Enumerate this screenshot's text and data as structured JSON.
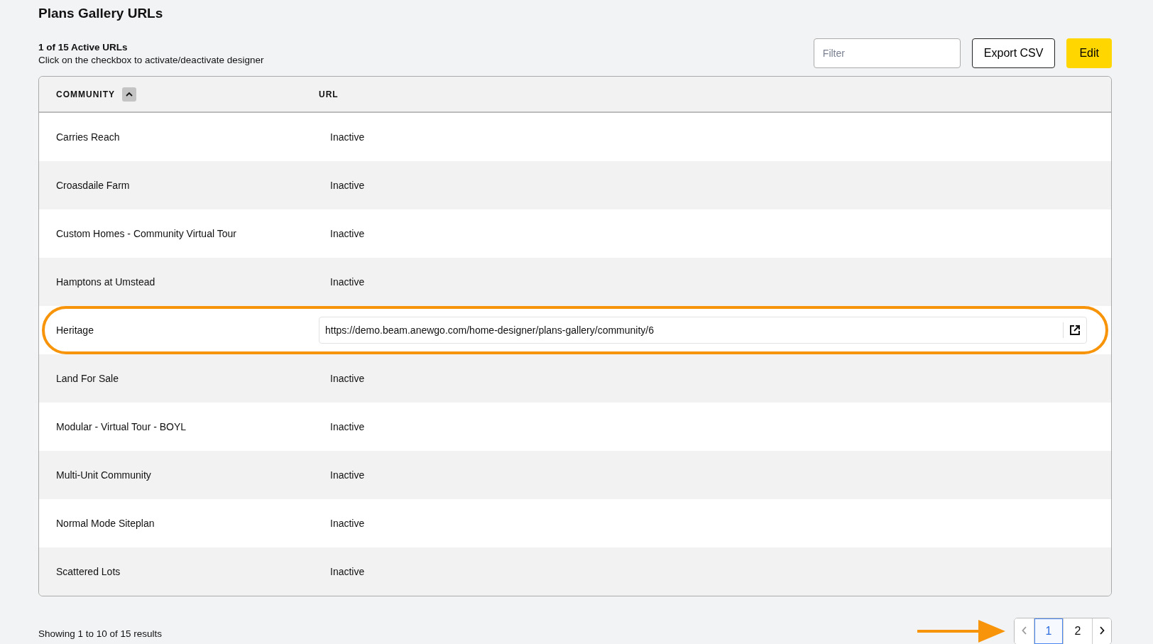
{
  "title": "Plans Gallery URLs",
  "summary": {
    "count": "1 of 15 Active URLs",
    "hint": "Click on the checkbox to activate/deactivate designer"
  },
  "filter": {
    "placeholder": "Filter"
  },
  "buttons": [
    {
      "label": "Export CSV",
      "kind": "outline"
    },
    {
      "label": "Edit",
      "kind": "primary"
    }
  ],
  "table": {
    "columns": [
      {
        "label": "COMMUNITY",
        "sorted": true
      },
      {
        "label": "URL",
        "sorted": false
      }
    ],
    "rows": [
      {
        "community": "Carries Reach",
        "active": false,
        "url": "Inactive",
        "annotated": false
      },
      {
        "community": "Croasdaile Farm",
        "active": false,
        "url": "Inactive",
        "annotated": false
      },
      {
        "community": "Custom Homes - Community Virtual Tour",
        "active": false,
        "url": "Inactive",
        "annotated": false
      },
      {
        "community": "Hamptons at Umstead",
        "active": false,
        "url": "Inactive",
        "annotated": false
      },
      {
        "community": "Heritage",
        "active": true,
        "url": "https://demo.beam.anewgo.com/home-designer/plans-gallery/community/6",
        "annotated": true
      },
      {
        "community": "Land For Sale",
        "active": false,
        "url": "Inactive",
        "annotated": false
      },
      {
        "community": "Modular - Virtual Tour - BOYL",
        "active": false,
        "url": "Inactive",
        "annotated": false
      },
      {
        "community": "Multi-Unit Community",
        "active": false,
        "url": "Inactive",
        "annotated": false
      },
      {
        "community": "Normal Mode Siteplan",
        "active": false,
        "url": "Inactive",
        "annotated": false
      },
      {
        "community": "Scattered Lots",
        "active": false,
        "url": "Inactive",
        "annotated": false
      }
    ]
  },
  "footer": {
    "results": "Showing 1 to 10 of 15 results",
    "arrow_annotation": true
  },
  "pagination": {
    "prev_disabled": true,
    "next_disabled": false,
    "pages": [
      {
        "label": "1",
        "selected": true
      },
      {
        "label": "2",
        "selected": false
      }
    ]
  }
}
